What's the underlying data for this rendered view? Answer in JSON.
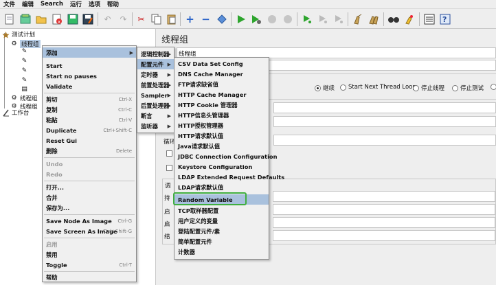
{
  "menubar": [
    "文件",
    "编辑",
    "Search",
    "运行",
    "选项",
    "帮助"
  ],
  "toolbar_icons": [
    "new-icon",
    "templates-icon",
    "open-icon",
    "close-file-icon",
    "save-icon",
    "save-as-icon",
    "undo-icon",
    "redo-icon",
    "cut-icon",
    "copy-icon",
    "paste-icon",
    "expand-icon",
    "collapse-icon",
    "toggle-icon",
    "start-icon",
    "start-no-pause-icon",
    "stop-icon",
    "shutdown-icon",
    "remote-start-icon",
    "remote-stop-icon",
    "remote-shutdown-icon",
    "clear-icon",
    "clear-all-icon",
    "search-icon",
    "reset-search-icon",
    "function-helper-icon",
    "help-icon"
  ],
  "tree": {
    "test_plan": "测试计划",
    "thread_group": "线程组",
    "thread_group_2": "线程组",
    "thread_group_3": "线程组",
    "workbench": "工作台"
  },
  "panel": {
    "title": "线程组",
    "name_value": "线程组",
    "radios": [
      "继续",
      "Start Next Thread Loop",
      "停止线程",
      "停止测试"
    ],
    "left_labels": [
      "循环",
      "调",
      "持",
      "启",
      "启",
      "结"
    ]
  },
  "context_menu": {
    "items": [
      {
        "label": "添加",
        "submenu": true,
        "hl": true
      },
      {
        "label": "Start"
      },
      {
        "label": "Start no pauses"
      },
      {
        "label": "Validate"
      },
      {
        "label": "剪切",
        "sc": "Ctrl-X"
      },
      {
        "label": "复制",
        "sc": "Ctrl-C"
      },
      {
        "label": "粘贴",
        "sc": "Ctrl-V"
      },
      {
        "label": "Duplicate",
        "sc": "Ctrl+Shift-C"
      },
      {
        "label": "Reset Gui"
      },
      {
        "label": "删除",
        "sc": "Delete"
      },
      {
        "label": "Undo",
        "disabled": true
      },
      {
        "label": "Redo",
        "disabled": true
      },
      {
        "label": "打开..."
      },
      {
        "label": "合并"
      },
      {
        "label": "保存为..."
      },
      {
        "label": "Save Node As Image",
        "sc": "Ctrl-G"
      },
      {
        "label": "Save Screen As Image",
        "sc": "Ctrl+Shift-G"
      },
      {
        "label": "启用",
        "disabled": true
      },
      {
        "label": "禁用"
      },
      {
        "label": "Toggle",
        "sc": "Ctrl-T"
      },
      {
        "label": "帮助"
      }
    ]
  },
  "add_submenu": {
    "items": [
      "逻辑控制器",
      "配置元件",
      "定时器",
      "前置处理器",
      "Sampler",
      "后置处理器",
      "断言",
      "监听器"
    ]
  },
  "config_submenu": {
    "items": [
      "CSV Data Set Config",
      "DNS Cache Manager",
      "FTP请求缺省值",
      "HTTP Cache Manager",
      "HTTP Cookie 管理器",
      "HTTP信息头管理器",
      "HTTP授权管理器",
      "HTTP请求默认值",
      "Java请求默认值",
      "JDBC Connection Configuration",
      "Keystore Configuration",
      "LDAP Extended Request Defaults",
      "LDAP请求默认值",
      "Random Variable",
      "TCP取样器配置",
      "用户定义的变量",
      "登陆配置元件/素",
      "简单配置元件",
      "计数器"
    ],
    "highlighted": "Random Variable"
  },
  "colors": {
    "highlight": "#a9c1dd",
    "annotation_border": "#3fae3f",
    "tree_selection": "#b7cde6"
  }
}
